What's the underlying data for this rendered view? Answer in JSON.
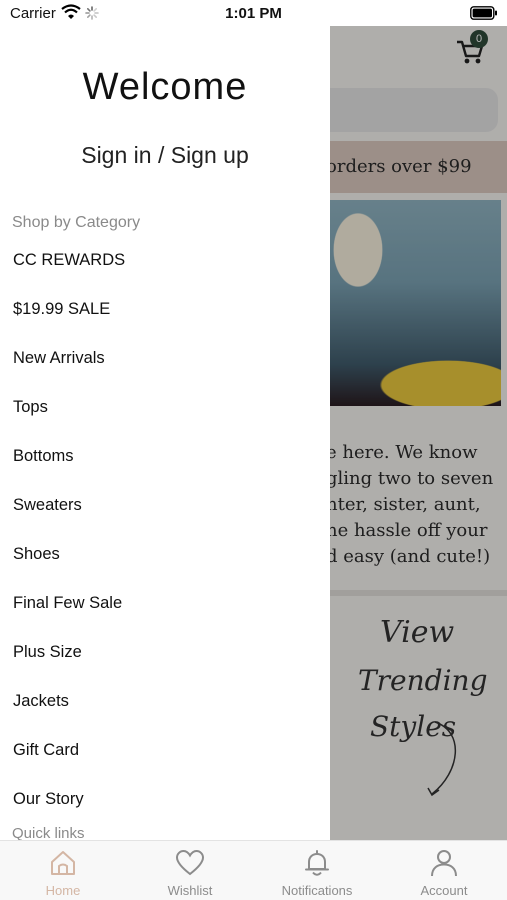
{
  "status_bar": {
    "carrier": "Carrier",
    "time": "1:01 PM"
  },
  "background": {
    "cart_count": "0",
    "promo_text": "orders over $99",
    "body_lines": [
      "e here. We know",
      "gling two to seven",
      "nter, sister, aunt,",
      "ne hassle off your",
      "d easy (and cute!)"
    ],
    "script_lines": [
      "View",
      "Trending",
      "Styles"
    ]
  },
  "drawer": {
    "welcome": "Welcome",
    "signin": "Sign in / Sign up",
    "section_label": "Shop by Category",
    "items": [
      {
        "label": "CC REWARDS"
      },
      {
        "label": "$19.99 SALE"
      },
      {
        "label": "New Arrivals"
      },
      {
        "label": "Tops"
      },
      {
        "label": "Bottoms"
      },
      {
        "label": "Sweaters"
      },
      {
        "label": "Shoes"
      },
      {
        "label": "Final Few Sale"
      },
      {
        "label": "Plus Size"
      },
      {
        "label": "Jackets"
      },
      {
        "label": "Gift Card"
      },
      {
        "label": "Our Story"
      }
    ],
    "quick_links_label": "Quick links"
  },
  "tab_bar": {
    "tabs": [
      {
        "label": "Home",
        "icon": "home-icon",
        "active": true
      },
      {
        "label": "Wishlist",
        "icon": "heart-icon",
        "active": false
      },
      {
        "label": "Notifications",
        "icon": "bell-icon",
        "active": false
      },
      {
        "label": "Account",
        "icon": "person-icon",
        "active": false
      }
    ]
  },
  "colors": {
    "active_tab": "#d4b6a4",
    "inactive_tab": "#8c8c8c",
    "promo_bg": "#d8c6bd",
    "cart_badge": "#2f4a3a"
  }
}
